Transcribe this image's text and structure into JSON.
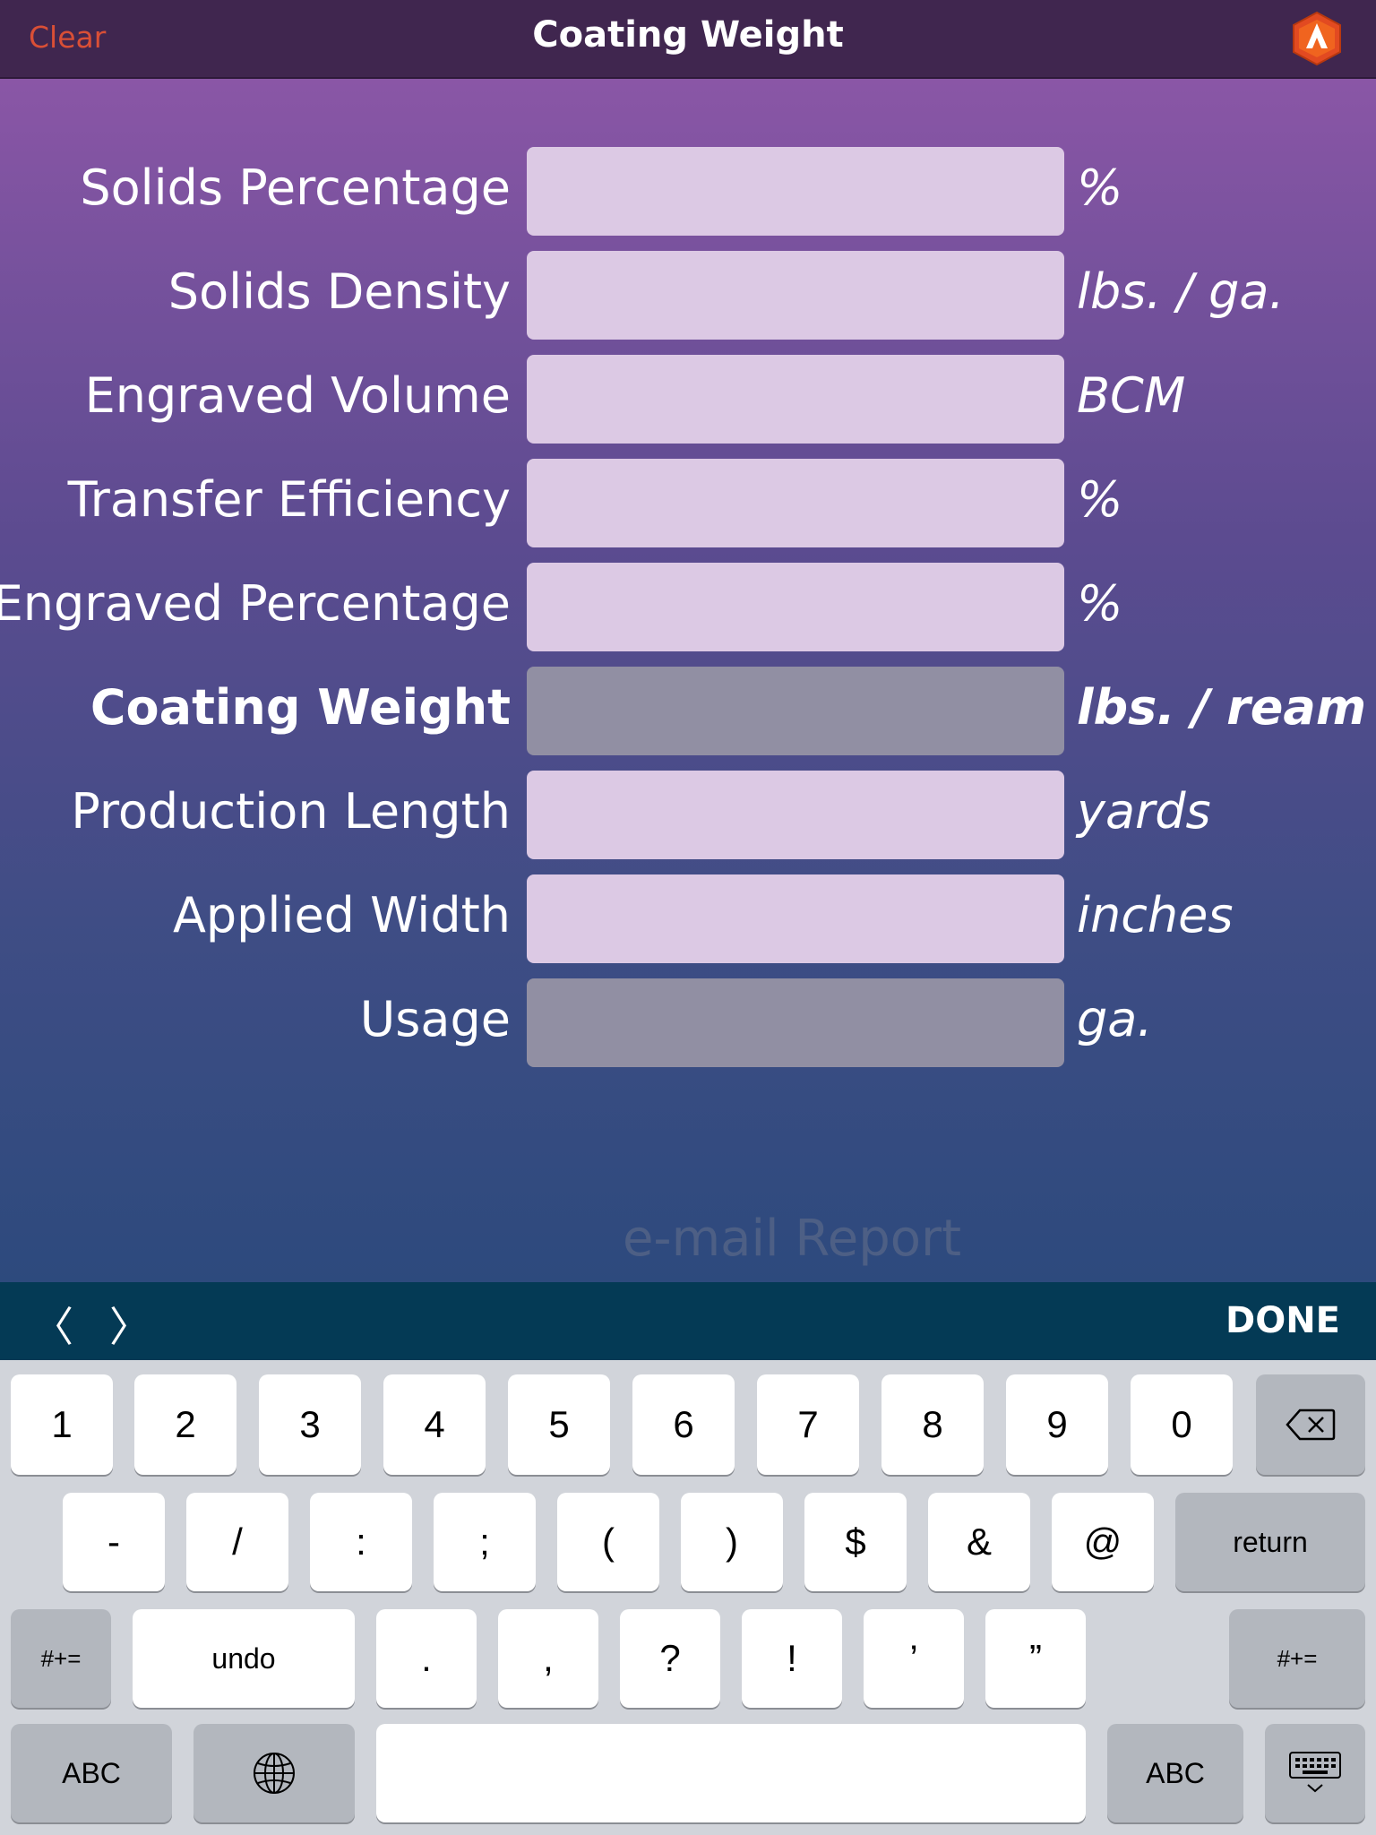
{
  "navbar": {
    "clear_label": "Clear",
    "title": "Coating Weight",
    "logo_icon": "app-logo-icon",
    "accent_color": "#d94f36"
  },
  "form": {
    "rows": [
      {
        "label": "Solids Percentage",
        "value": "",
        "unit": "%",
        "computed": false
      },
      {
        "label": "Solids Density",
        "value": "",
        "unit": "lbs. / ga.",
        "computed": false
      },
      {
        "label": "Engraved Volume",
        "value": "",
        "unit": "BCM",
        "computed": false
      },
      {
        "label": "Transfer Efficiency",
        "value": "",
        "unit": "%",
        "computed": false
      },
      {
        "label": "Engraved Percentage",
        "value": "",
        "unit": "%",
        "computed": false
      },
      {
        "label": "Coating Weight",
        "value": "",
        "unit": "lbs. / ream",
        "computed": true
      },
      {
        "label": "Production Length",
        "value": "",
        "unit": "yards",
        "computed": false
      },
      {
        "label": "Applied Width",
        "value": "",
        "unit": "inches",
        "computed": false
      },
      {
        "label": "Usage",
        "value": "",
        "unit": "ga.",
        "computed": true
      }
    ]
  },
  "email_report_label": "e-mail Report",
  "accessory": {
    "prev_glyph": "〈",
    "next_glyph": "〉",
    "done_label": "DONE"
  },
  "keyboard": {
    "row1": [
      "1",
      "2",
      "3",
      "4",
      "5",
      "6",
      "7",
      "8",
      "9",
      "0"
    ],
    "row2": [
      "-",
      "/",
      ":",
      ";",
      "(",
      ")",
      "$",
      "&",
      "@"
    ],
    "return_label": "return",
    "row3_symbols_label": "#+=",
    "undo_label": "undo",
    "row3": [
      ".",
      ",",
      "?",
      "!",
      "’",
      "”"
    ],
    "abc_label": "ABC",
    "globe_icon": "globe-icon",
    "backspace_icon": "backspace-icon",
    "dismiss_icon": "keyboard-dismiss-icon"
  }
}
